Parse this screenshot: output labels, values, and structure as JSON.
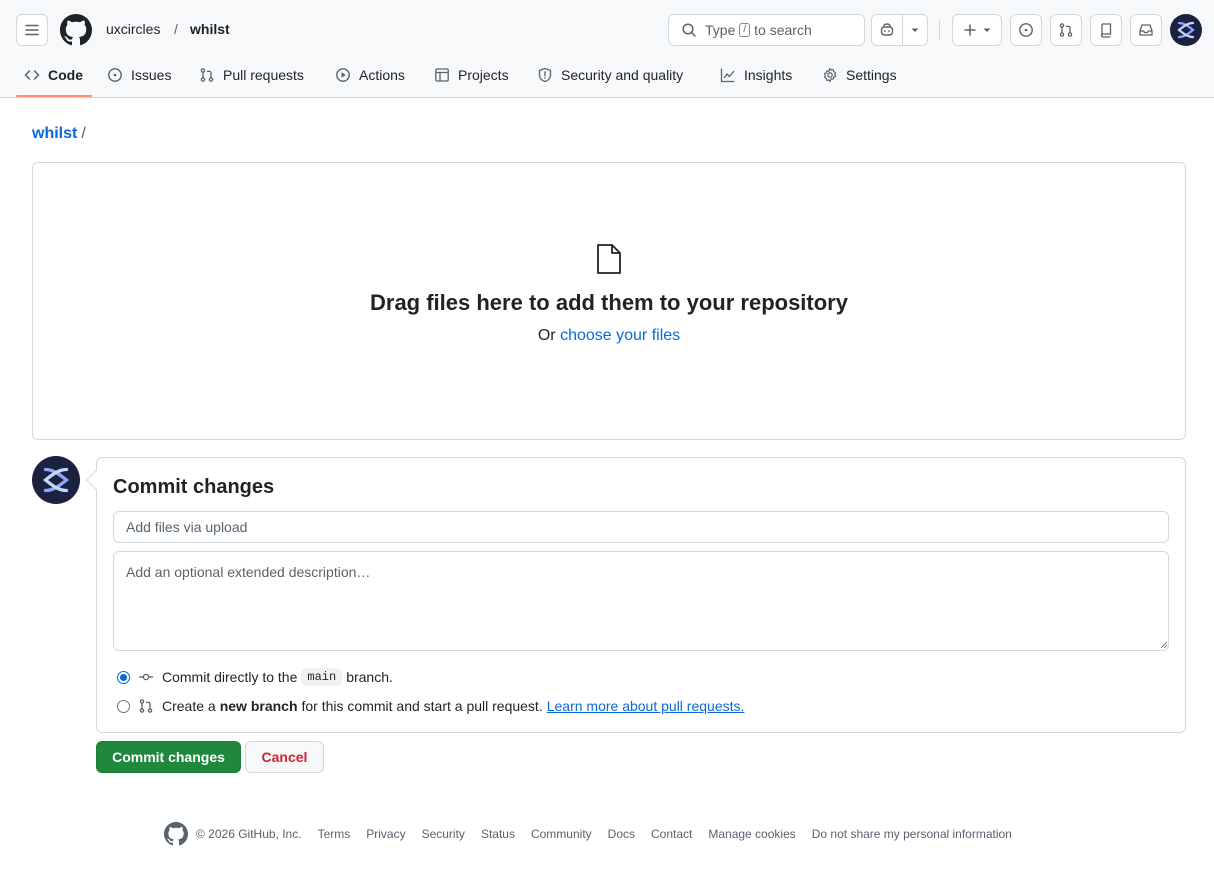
{
  "header": {
    "owner": "uxcircles",
    "separator": "/",
    "repo": "whilst",
    "search": {
      "prefix": "Type",
      "key": "/",
      "suffix": "to search"
    }
  },
  "tabs": [
    {
      "label": "Code",
      "icon": "code-icon",
      "active": true
    },
    {
      "label": "Issues",
      "icon": "issue-opened-icon"
    },
    {
      "label": "Pull requests",
      "icon": "git-pull-request-icon"
    },
    {
      "label": "Actions",
      "icon": "play-icon"
    },
    {
      "label": "Projects",
      "icon": "table-icon"
    },
    {
      "label": "Security and quality",
      "icon": "shield-icon"
    },
    {
      "label": "Insights",
      "icon": "graph-icon"
    },
    {
      "label": "Settings",
      "icon": "gear-icon"
    }
  ],
  "path": {
    "repo": "whilst",
    "slash": "/"
  },
  "dropzone": {
    "title": "Drag files here to add them to your repository",
    "or": "Or",
    "choose": "choose your files"
  },
  "commit": {
    "title": "Commit changes",
    "summary_placeholder": "Add files via upload",
    "description_placeholder": "Add an optional extended description…",
    "option_direct": {
      "prefix": "Commit directly to the",
      "branch": "main",
      "suffix": "branch.",
      "checked": true
    },
    "option_branch": {
      "prefix": "Create a",
      "bold": "new branch",
      "suffix": "for this commit and start a pull request.",
      "link": "Learn more about pull requests.",
      "checked": false
    },
    "submit_label": "Commit changes",
    "cancel_label": "Cancel"
  },
  "footer": {
    "copyright": "© 2026 GitHub, Inc.",
    "links": [
      "Terms",
      "Privacy",
      "Security",
      "Status",
      "Community",
      "Docs",
      "Contact",
      "Manage cookies",
      "Do not share my personal information"
    ]
  },
  "colors": {
    "accent": "#0969da",
    "primary_button": "#1f883d",
    "danger": "#d1242f",
    "tab_underline": "#fd8c73",
    "avatar_bg": "#1a2240"
  }
}
